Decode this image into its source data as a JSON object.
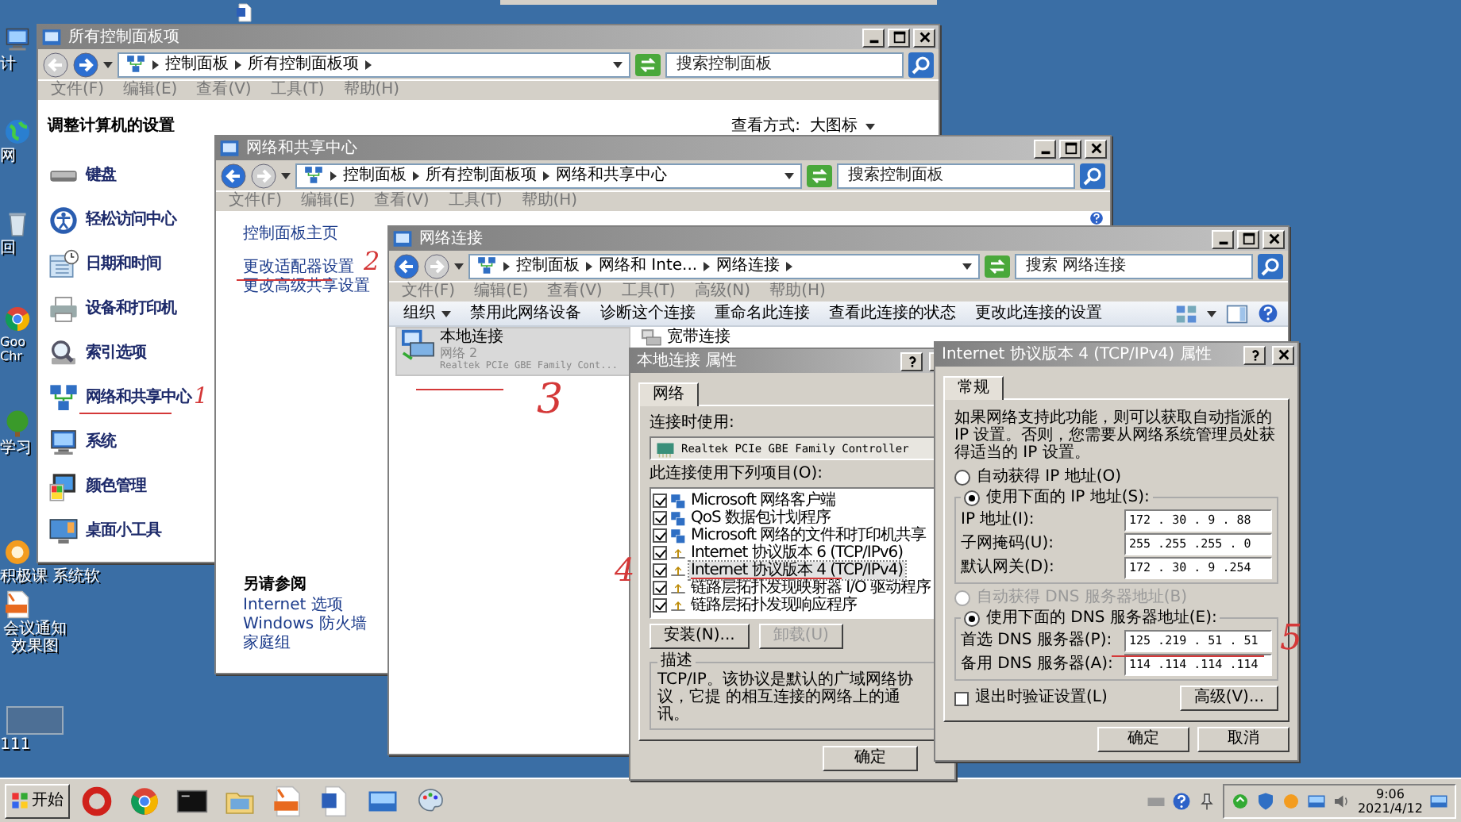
{
  "desktop_icons": [
    {
      "label": "计"
    },
    {
      "label": "网"
    },
    {
      "label": "回"
    },
    {
      "label": "Goo Chr"
    },
    {
      "label": "学习"
    },
    {
      "label": "积极课 系统软"
    },
    {
      "label": "会议通知效果图"
    },
    {
      "label": "111"
    }
  ],
  "control_panel": {
    "title": "所有控制面板项",
    "back_enabled": false,
    "forward_enabled": true,
    "breadcrumb": [
      "控制面板",
      "所有控制面板项"
    ],
    "trailing_arrow": true,
    "search": {
      "placeholder": "搜索控制面板"
    },
    "menu": [
      "文件(F)",
      "编辑(E)",
      "查看(V)",
      "工具(T)",
      "帮助(H)"
    ],
    "heading": "调整计算机的设置",
    "view_label": "查看方式:",
    "view_value": "大图标",
    "items": [
      {
        "label": "键盘"
      },
      {
        "label": "轻松访问中心"
      },
      {
        "label": "日期和时间"
      },
      {
        "label": "设备和打印机"
      },
      {
        "label": "索引选项"
      },
      {
        "label": "网络和共享中心",
        "pen_mark": "1"
      },
      {
        "label": "系统"
      },
      {
        "label": "颜色管理"
      },
      {
        "label": "桌面小工具"
      }
    ]
  },
  "network_center": {
    "title": "网络和共享中心",
    "back_enabled": true,
    "forward_enabled": false,
    "breadcrumb": [
      "控制面板",
      "所有控制面板项",
      "网络和共享中心"
    ],
    "trailing_arrow": false,
    "search": {
      "placeholder": "搜索控制面板"
    },
    "menu": [
      "文件(F)",
      "编辑(E)",
      "查看(V)",
      "工具(T)",
      "帮助(H)"
    ],
    "links": [
      {
        "label": "控制面板主页"
      },
      {
        "label": "更改适配器设置",
        "pen_mark": "2"
      },
      {
        "label": "更改高级共享设置"
      }
    ],
    "see_also_title": "另请参阅",
    "see_also": [
      "Internet 选项",
      "Windows 防火墙",
      "家庭组"
    ]
  },
  "network_connections": {
    "title": "网络连接",
    "back_enabled": true,
    "forward_enabled": false,
    "breadcrumb": [
      "控制面板",
      "网络和 Inte...",
      "网络连接"
    ],
    "trailing_arrow": true,
    "search": {
      "placeholder": "搜索 网络连接"
    },
    "menu": [
      "文件(F)",
      "编辑(E)",
      "查看(V)",
      "工具(T)",
      "高级(N)",
      "帮助(H)"
    ],
    "toolbar": [
      {
        "label": "组织",
        "dropdown": true
      },
      {
        "label": "禁用此网络设备",
        "dropdown": false
      },
      {
        "label": "诊断这个连接",
        "dropdown": false
      },
      {
        "label": "重命名此连接",
        "dropdown": false
      },
      {
        "label": "查看此连接的状态",
        "dropdown": false
      },
      {
        "label": "更改此连接的设置",
        "dropdown": false
      }
    ],
    "connections": [
      {
        "name": "本地连接",
        "status": "网络 2",
        "device": "Realtek PCIe GBE Family Cont...",
        "selected": true,
        "pen_mark": "3"
      },
      {
        "name": "宽带连接",
        "selected": false
      }
    ]
  },
  "lan_properties": {
    "title": "本地连接 属性",
    "tabs": [
      {
        "label": "网络",
        "selected": true
      }
    ],
    "connect_label": "连接时使用:",
    "adapter": "Realtek PCIe GBE Family Controller",
    "list_label": "此连接使用下列项目(O):",
    "components": [
      {
        "label": "Microsoft 网络客户端",
        "checked": true,
        "selected": false
      },
      {
        "label": "QoS 数据包计划程序",
        "checked": true,
        "selected": false
      },
      {
        "label": "Microsoft 网络的文件和打印机共享",
        "checked": true,
        "selected": false
      },
      {
        "label": "Internet 协议版本 6 (TCP/IPv6)",
        "checked": true,
        "selected": false
      },
      {
        "label": "Internet 协议版本 4 (TCP/IPv4)",
        "checked": true,
        "selected": true,
        "pen_mark": "4"
      },
      {
        "label": "链路层拓扑发现映射器 I/O 驱动程序",
        "checked": true,
        "selected": false
      },
      {
        "label": "链路层拓扑发现响应程序",
        "checked": true,
        "selected": false
      }
    ],
    "buttons": [
      {
        "label": "安装(N)...",
        "disabled": false
      },
      {
        "label": "卸载(U)",
        "disabled": true
      }
    ],
    "description_label": "描述",
    "description": "TCP/IP。该协议是默认的广域网络协议，它提 的相互连接的网络上的通讯。",
    "ok": "确定"
  },
  "ipv4_properties": {
    "title": "Internet 协议版本 4 (TCP/IPv4) 属性",
    "tabs": [
      {
        "label": "常规",
        "selected": true
      }
    ],
    "intro": "如果网络支持此功能，则可以获取自动指派的 IP 设置。否则，您需要从网络系统管理员处获得适当的 IP 设置。",
    "ip_modes": [
      {
        "label": "自动获得 IP 地址(O)",
        "selected": false,
        "disabled": false
      },
      {
        "label": "使用下面的 IP 地址(S):",
        "selected": true,
        "disabled": false
      }
    ],
    "ip_fields": [
      {
        "label": "IP 地址(I):",
        "value": "172 . 30 . 9 . 88"
      },
      {
        "label": "子网掩码(U):",
        "value": "255 .255 .255 . 0"
      },
      {
        "label": "默认网关(D):",
        "value": "172 . 30 . 9 .254"
      }
    ],
    "dns_modes": [
      {
        "label": "自动获得 DNS 服务器地址(B)",
        "selected": false,
        "disabled": true
      },
      {
        "label": "使用下面的 DNS 服务器地址(E):",
        "selected": true,
        "disabled": false
      }
    ],
    "dns_fields": [
      {
        "label": "首选 DNS 服务器(P):",
        "value": "125 .219 . 51 . 51",
        "pen_mark": "5"
      },
      {
        "label": "备用 DNS 服务器(A):",
        "value": "114 .114 .114 .114"
      }
    ],
    "validate": {
      "label": "退出时验证设置(L)",
      "checked": false
    },
    "advanced": "高级(V)...",
    "ok": "确定",
    "cancel": "取消"
  },
  "taskbar": {
    "start": "开始",
    "time": "9:06",
    "date": "2021/4/12"
  }
}
